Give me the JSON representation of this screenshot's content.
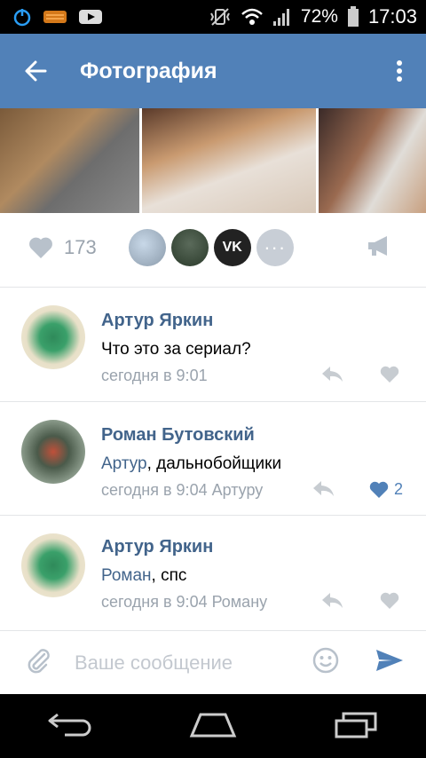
{
  "status_bar": {
    "battery": "72%",
    "time": "17:03"
  },
  "toolbar": {
    "title": "Фотография"
  },
  "likes": {
    "count": "173",
    "liker_overflow": "···",
    "vk_avatar_text": "VK"
  },
  "comments": [
    {
      "author": "Артур Яркин",
      "mention": "",
      "text": "Что это за сериал?",
      "time": "сегодня в 9:01",
      "likes": ""
    },
    {
      "author": "Роман Бутовский",
      "mention": "Артур",
      "text": ", дальнобойщики",
      "time": "сегодня в 9:04 Артуру",
      "likes": "2"
    },
    {
      "author": "Артур Яркин",
      "mention": "Роман",
      "text": ", спс",
      "time": "сегодня в 9:04 Роману",
      "likes": ""
    }
  ],
  "composer": {
    "placeholder": "Ваше сообщение"
  },
  "colors": {
    "accent": "#5181b8",
    "link": "#42648b",
    "muted": "#9aa3ad"
  }
}
